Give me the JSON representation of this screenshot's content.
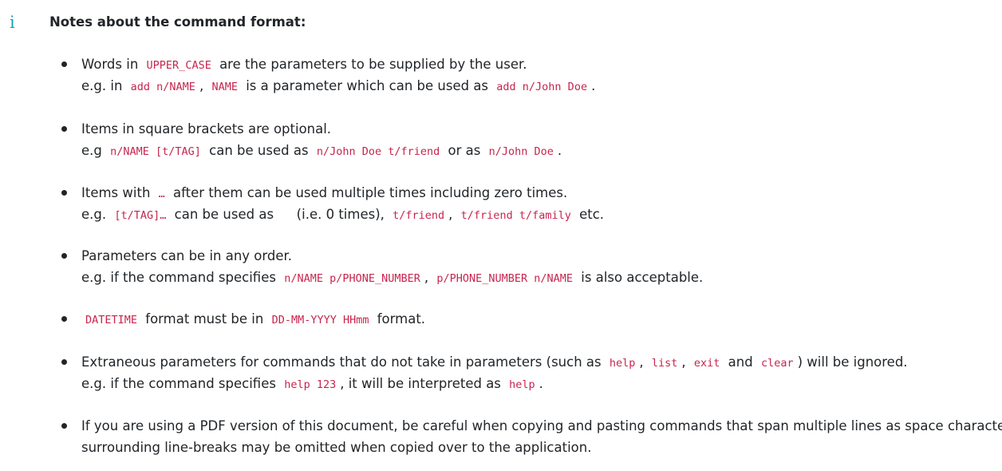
{
  "header": {
    "icon": "info-icon",
    "icon_glyph": "i",
    "title": "Notes about the command format:"
  },
  "accent_colors": {
    "icon": "#17a2b8",
    "code": "#c7254e"
  },
  "notes": [
    {
      "line1": [
        {
          "t": "Words in "
        },
        {
          "c": "UPPER_CASE"
        },
        {
          "t": " are the parameters to be supplied by the user."
        }
      ],
      "line2": [
        {
          "t": "e.g. in "
        },
        {
          "c": "add n/NAME"
        },
        {
          "t": ", "
        },
        {
          "c": "NAME"
        },
        {
          "t": " is a parameter which can be used as "
        },
        {
          "c": "add n/John Doe"
        },
        {
          "t": "."
        }
      ]
    },
    {
      "line1": [
        {
          "t": "Items in square brackets are optional."
        }
      ],
      "line2": [
        {
          "t": "e.g "
        },
        {
          "c": "n/NAME [t/TAG]"
        },
        {
          "t": " can be used as "
        },
        {
          "c": "n/John Doe t/friend"
        },
        {
          "t": " or as "
        },
        {
          "c": "n/John Doe"
        },
        {
          "t": "."
        }
      ]
    },
    {
      "line1": [
        {
          "t": "Items with "
        },
        {
          "c": "…"
        },
        {
          "t": " after them can be used multiple times including zero times."
        }
      ],
      "line2": [
        {
          "t": "e.g. "
        },
        {
          "c": "[t/TAG]…"
        },
        {
          "t": " can be used as "
        },
        {
          "c": " "
        },
        {
          "t": " (i.e. 0 times), "
        },
        {
          "c": "t/friend"
        },
        {
          "t": ", "
        },
        {
          "c": "t/friend t/family"
        },
        {
          "t": " etc."
        }
      ]
    },
    {
      "line1": [
        {
          "t": "Parameters can be in any order."
        }
      ],
      "line2": [
        {
          "t": "e.g. if the command specifies "
        },
        {
          "c": "n/NAME p/PHONE_NUMBER"
        },
        {
          "t": ", "
        },
        {
          "c": "p/PHONE_NUMBER n/NAME"
        },
        {
          "t": " is also acceptable."
        }
      ]
    },
    {
      "line1": [
        {
          "c": "DATETIME"
        },
        {
          "t": " format must be in "
        },
        {
          "c": "DD-MM-YYYY HHmm"
        },
        {
          "t": " format."
        }
      ]
    },
    {
      "line1": [
        {
          "t": "Extraneous parameters for commands that do not take in parameters (such as "
        },
        {
          "c": "help"
        },
        {
          "t": ", "
        },
        {
          "c": "list"
        },
        {
          "t": ", "
        },
        {
          "c": "exit"
        },
        {
          "t": " and "
        },
        {
          "c": "clear"
        },
        {
          "t": ") will be ignored."
        }
      ],
      "line2": [
        {
          "t": "e.g. if the command specifies "
        },
        {
          "c": "help 123"
        },
        {
          "t": ", it will be interpreted as "
        },
        {
          "c": "help"
        },
        {
          "t": "."
        }
      ]
    },
    {
      "line1": [
        {
          "t": "If you are using a PDF version of this document, be careful when copying and pasting commands that span multiple lines as space characters"
        }
      ],
      "line2": [
        {
          "t": "surrounding line-breaks may be omitted when copied over to the application."
        }
      ]
    }
  ]
}
